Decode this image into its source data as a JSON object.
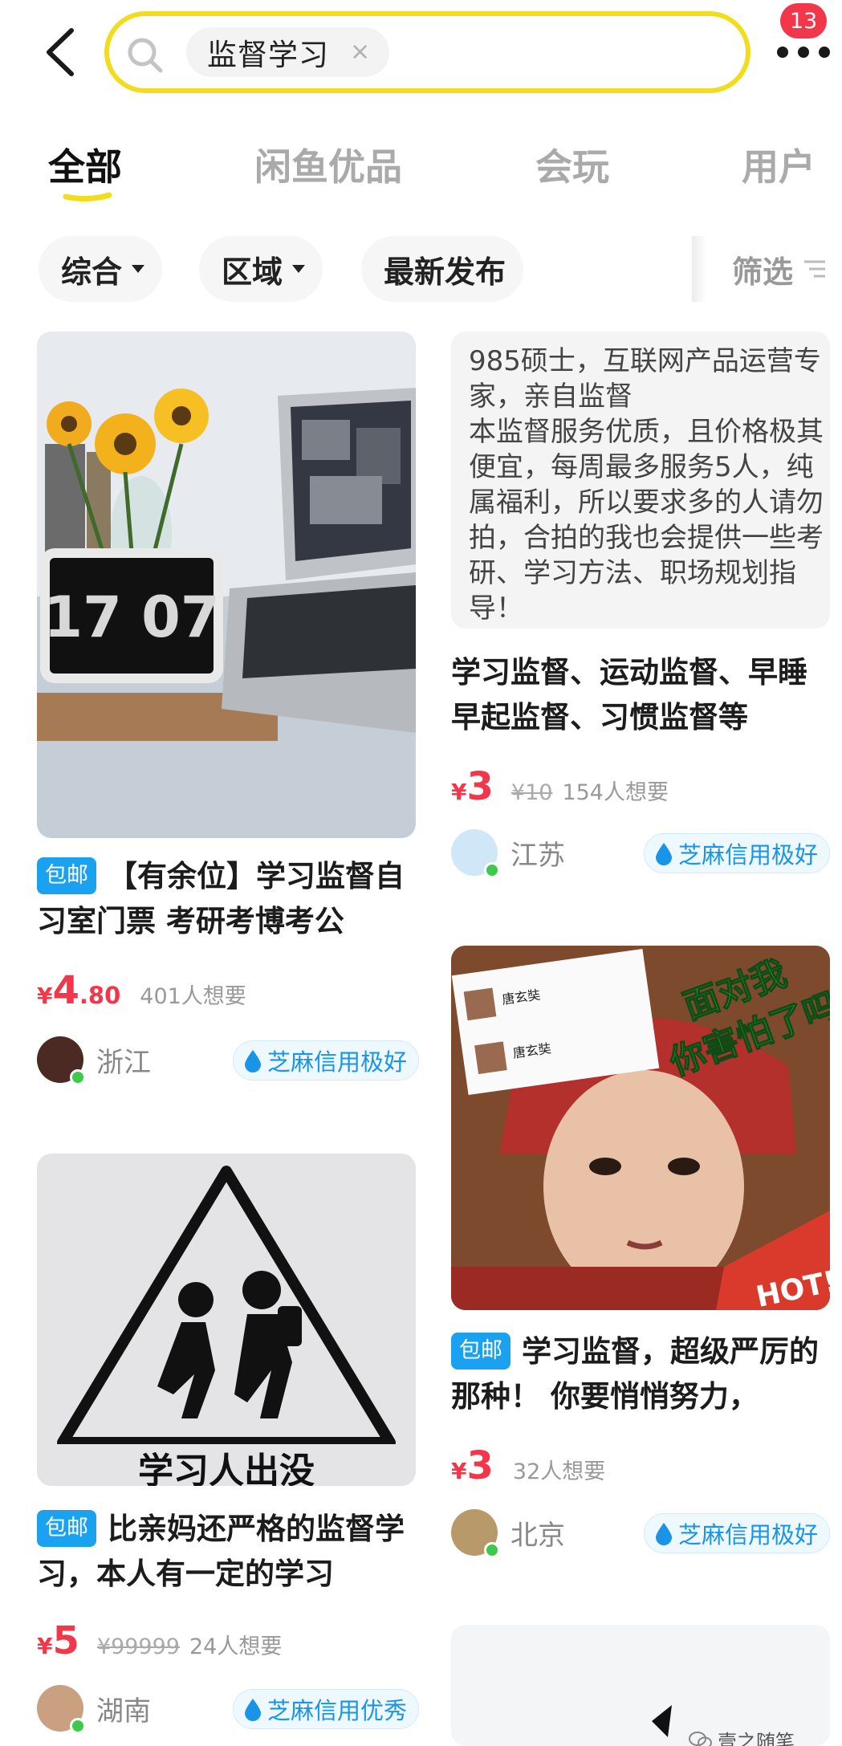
{
  "header": {
    "search_query": "监督学习",
    "clear_symbol": "×",
    "badge_count": "13"
  },
  "tabs": [
    {
      "label": "全部"
    },
    {
      "label": "闲鱼优品"
    },
    {
      "label": "会玩"
    },
    {
      "label": "用户"
    }
  ],
  "filters": {
    "chips": [
      {
        "label": "综合"
      },
      {
        "label": "区域"
      },
      {
        "label": "最新发布"
      }
    ],
    "filter_label": "筛选"
  },
  "cards": [
    {
      "image_text": "17 07",
      "postage_tag": "包邮",
      "title": "【有余位】学习监督自习室门票 考研考博考公",
      "currency": "¥",
      "price_int": "4",
      "price_dec": ".80",
      "want": "401人想要",
      "location": "浙江",
      "credit": "芝麻信用极好"
    },
    {
      "note_text": "985硕士，互联网产品运营专家，亲自监督\n本监督服务优质，且价格极其便宜，每周最多服务5人，纯属福利，所以要求多的人请勿拍，合拍的我也会提供一些考研、学习方法、职场规划指导！",
      "title": "学习监督、运动监督、早睡早起监督、习惯监督等",
      "currency": "¥",
      "price_int": "3",
      "orig_price": "¥10",
      "want": "154人想要",
      "location": "江苏",
      "credit": "芝麻信用极好"
    },
    {
      "image_caption": "学习人出没",
      "postage_tag": "包邮",
      "title": "比亲妈还严格的监督学习，本人有一定的学习",
      "currency": "¥",
      "price_int": "5",
      "orig_price": "¥99999",
      "want": "24人想要",
      "location": "湖南",
      "credit": "芝麻信用优秀"
    },
    {
      "image_overlay": "面对我\n你害怕了吗",
      "chat_name_1": "唐玄奘",
      "chat_name_2": "唐玄奘",
      "hot_tag": "HOT!",
      "postage_tag": "包邮",
      "title": "学习监督，超级严厉的那种！ 你要悄悄努力，",
      "currency": "¥",
      "price_int": "3",
      "want": "32人想要",
      "location": "北京",
      "credit": "芝麻信用极好"
    }
  ],
  "watermark": "壹之随笔",
  "colors": {
    "accent_yellow": "#f2dc1e",
    "price_red": "#f2374b",
    "postage_blue": "#1aa1f0",
    "credit_blue": "#1a94e6"
  }
}
